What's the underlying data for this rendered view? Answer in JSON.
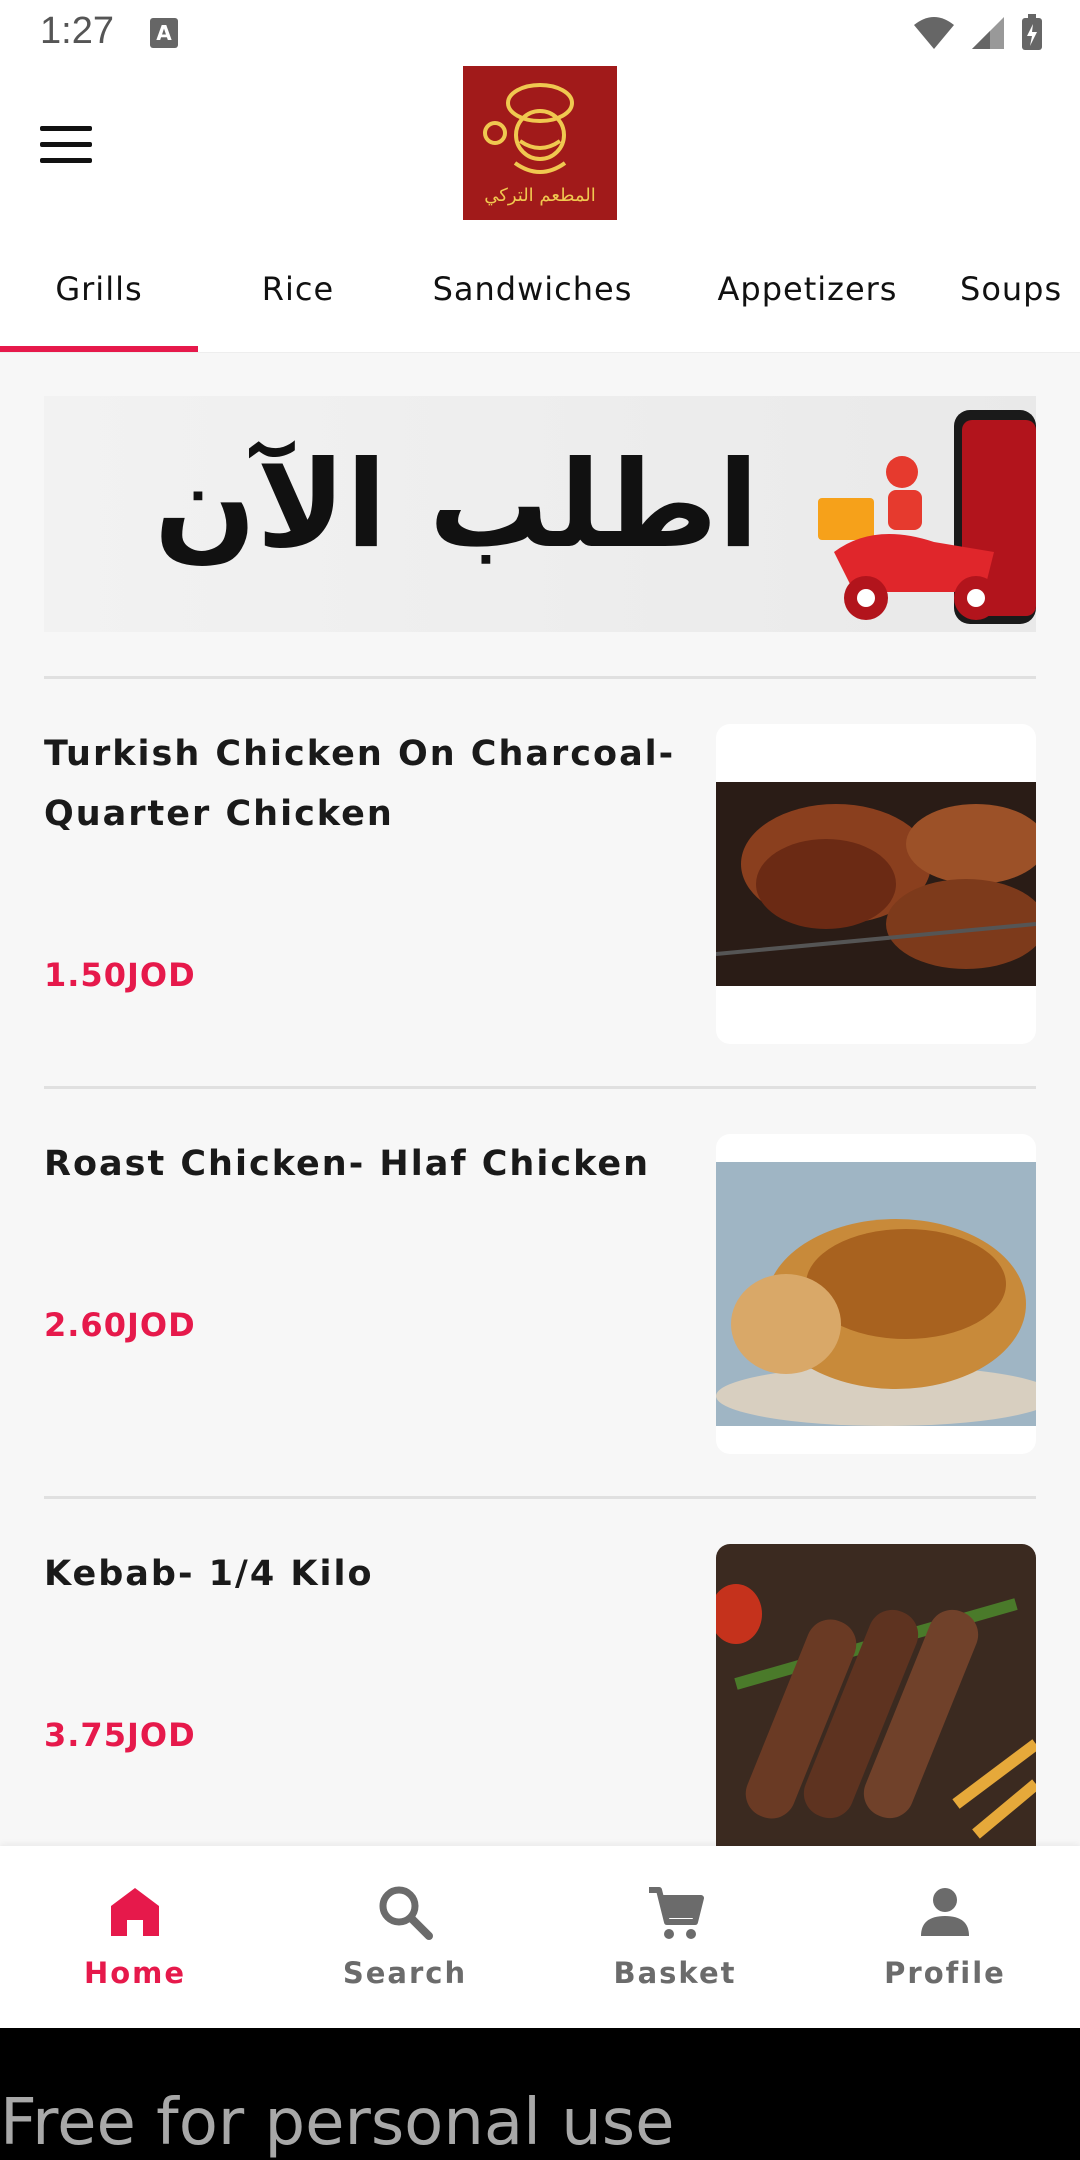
{
  "status_bar": {
    "time": "1:27",
    "badge": "A"
  },
  "header": {
    "logo_alt": "restaurant logo",
    "logo_text": "المطعم التركي"
  },
  "tabs": [
    {
      "label": "Grills",
      "active": true
    },
    {
      "label": "Rice",
      "active": false
    },
    {
      "label": "Sandwiches",
      "active": false
    },
    {
      "label": "Appetizers",
      "active": false
    },
    {
      "label": "Soups",
      "active": false
    }
  ],
  "banner": {
    "text": "اطلب الآن"
  },
  "items": [
    {
      "title": "Turkish Chicken On Charcoal- Quarter Chicken",
      "price": "1.50JOD"
    },
    {
      "title": "Roast Chicken- Hlaf Chicken",
      "price": "2.60JOD"
    },
    {
      "title": "Kebab- 1/4 Kilo",
      "price": "3.75JOD"
    }
  ],
  "bottom_nav": [
    {
      "label": "Home",
      "icon": "home-icon",
      "active": true
    },
    {
      "label": "Search",
      "icon": "search-icon",
      "active": false
    },
    {
      "label": "Basket",
      "icon": "cart-icon",
      "active": false
    },
    {
      "label": "Profile",
      "icon": "person-icon",
      "active": false
    }
  ],
  "watermark": "Free for personal use",
  "colors": {
    "accent": "#e6194b",
    "logo_bg": "#a11a1a",
    "text": "#1a1a1a",
    "inactive": "#6b6b6b"
  }
}
